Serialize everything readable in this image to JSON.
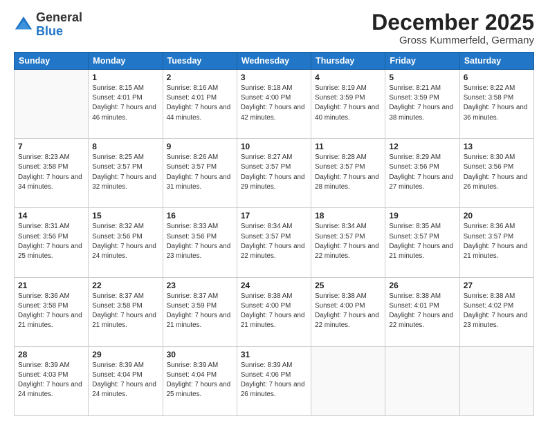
{
  "logo": {
    "general": "General",
    "blue": "Blue"
  },
  "header": {
    "month": "December 2025",
    "location": "Gross Kummerfeld, Germany"
  },
  "days_of_week": [
    "Sunday",
    "Monday",
    "Tuesday",
    "Wednesday",
    "Thursday",
    "Friday",
    "Saturday"
  ],
  "weeks": [
    [
      {
        "day": "",
        "sunrise": "",
        "sunset": "",
        "daylight": ""
      },
      {
        "day": "1",
        "sunrise": "Sunrise: 8:15 AM",
        "sunset": "Sunset: 4:01 PM",
        "daylight": "Daylight: 7 hours and 46 minutes."
      },
      {
        "day": "2",
        "sunrise": "Sunrise: 8:16 AM",
        "sunset": "Sunset: 4:01 PM",
        "daylight": "Daylight: 7 hours and 44 minutes."
      },
      {
        "day": "3",
        "sunrise": "Sunrise: 8:18 AM",
        "sunset": "Sunset: 4:00 PM",
        "daylight": "Daylight: 7 hours and 42 minutes."
      },
      {
        "day": "4",
        "sunrise": "Sunrise: 8:19 AM",
        "sunset": "Sunset: 3:59 PM",
        "daylight": "Daylight: 7 hours and 40 minutes."
      },
      {
        "day": "5",
        "sunrise": "Sunrise: 8:21 AM",
        "sunset": "Sunset: 3:59 PM",
        "daylight": "Daylight: 7 hours and 38 minutes."
      },
      {
        "day": "6",
        "sunrise": "Sunrise: 8:22 AM",
        "sunset": "Sunset: 3:58 PM",
        "daylight": "Daylight: 7 hours and 36 minutes."
      }
    ],
    [
      {
        "day": "7",
        "sunrise": "Sunrise: 8:23 AM",
        "sunset": "Sunset: 3:58 PM",
        "daylight": "Daylight: 7 hours and 34 minutes."
      },
      {
        "day": "8",
        "sunrise": "Sunrise: 8:25 AM",
        "sunset": "Sunset: 3:57 PM",
        "daylight": "Daylight: 7 hours and 32 minutes."
      },
      {
        "day": "9",
        "sunrise": "Sunrise: 8:26 AM",
        "sunset": "Sunset: 3:57 PM",
        "daylight": "Daylight: 7 hours and 31 minutes."
      },
      {
        "day": "10",
        "sunrise": "Sunrise: 8:27 AM",
        "sunset": "Sunset: 3:57 PM",
        "daylight": "Daylight: 7 hours and 29 minutes."
      },
      {
        "day": "11",
        "sunrise": "Sunrise: 8:28 AM",
        "sunset": "Sunset: 3:57 PM",
        "daylight": "Daylight: 7 hours and 28 minutes."
      },
      {
        "day": "12",
        "sunrise": "Sunrise: 8:29 AM",
        "sunset": "Sunset: 3:56 PM",
        "daylight": "Daylight: 7 hours and 27 minutes."
      },
      {
        "day": "13",
        "sunrise": "Sunrise: 8:30 AM",
        "sunset": "Sunset: 3:56 PM",
        "daylight": "Daylight: 7 hours and 26 minutes."
      }
    ],
    [
      {
        "day": "14",
        "sunrise": "Sunrise: 8:31 AM",
        "sunset": "Sunset: 3:56 PM",
        "daylight": "Daylight: 7 hours and 25 minutes."
      },
      {
        "day": "15",
        "sunrise": "Sunrise: 8:32 AM",
        "sunset": "Sunset: 3:56 PM",
        "daylight": "Daylight: 7 hours and 24 minutes."
      },
      {
        "day": "16",
        "sunrise": "Sunrise: 8:33 AM",
        "sunset": "Sunset: 3:56 PM",
        "daylight": "Daylight: 7 hours and 23 minutes."
      },
      {
        "day": "17",
        "sunrise": "Sunrise: 8:34 AM",
        "sunset": "Sunset: 3:57 PM",
        "daylight": "Daylight: 7 hours and 22 minutes."
      },
      {
        "day": "18",
        "sunrise": "Sunrise: 8:34 AM",
        "sunset": "Sunset: 3:57 PM",
        "daylight": "Daylight: 7 hours and 22 minutes."
      },
      {
        "day": "19",
        "sunrise": "Sunrise: 8:35 AM",
        "sunset": "Sunset: 3:57 PM",
        "daylight": "Daylight: 7 hours and 21 minutes."
      },
      {
        "day": "20",
        "sunrise": "Sunrise: 8:36 AM",
        "sunset": "Sunset: 3:57 PM",
        "daylight": "Daylight: 7 hours and 21 minutes."
      }
    ],
    [
      {
        "day": "21",
        "sunrise": "Sunrise: 8:36 AM",
        "sunset": "Sunset: 3:58 PM",
        "daylight": "Daylight: 7 hours and 21 minutes."
      },
      {
        "day": "22",
        "sunrise": "Sunrise: 8:37 AM",
        "sunset": "Sunset: 3:58 PM",
        "daylight": "Daylight: 7 hours and 21 minutes."
      },
      {
        "day": "23",
        "sunrise": "Sunrise: 8:37 AM",
        "sunset": "Sunset: 3:59 PM",
        "daylight": "Daylight: 7 hours and 21 minutes."
      },
      {
        "day": "24",
        "sunrise": "Sunrise: 8:38 AM",
        "sunset": "Sunset: 4:00 PM",
        "daylight": "Daylight: 7 hours and 21 minutes."
      },
      {
        "day": "25",
        "sunrise": "Sunrise: 8:38 AM",
        "sunset": "Sunset: 4:00 PM",
        "daylight": "Daylight: 7 hours and 22 minutes."
      },
      {
        "day": "26",
        "sunrise": "Sunrise: 8:38 AM",
        "sunset": "Sunset: 4:01 PM",
        "daylight": "Daylight: 7 hours and 22 minutes."
      },
      {
        "day": "27",
        "sunrise": "Sunrise: 8:38 AM",
        "sunset": "Sunset: 4:02 PM",
        "daylight": "Daylight: 7 hours and 23 minutes."
      }
    ],
    [
      {
        "day": "28",
        "sunrise": "Sunrise: 8:39 AM",
        "sunset": "Sunset: 4:03 PM",
        "daylight": "Daylight: 7 hours and 24 minutes."
      },
      {
        "day": "29",
        "sunrise": "Sunrise: 8:39 AM",
        "sunset": "Sunset: 4:04 PM",
        "daylight": "Daylight: 7 hours and 24 minutes."
      },
      {
        "day": "30",
        "sunrise": "Sunrise: 8:39 AM",
        "sunset": "Sunset: 4:04 PM",
        "daylight": "Daylight: 7 hours and 25 minutes."
      },
      {
        "day": "31",
        "sunrise": "Sunrise: 8:39 AM",
        "sunset": "Sunset: 4:06 PM",
        "daylight": "Daylight: 7 hours and 26 minutes."
      },
      {
        "day": "",
        "sunrise": "",
        "sunset": "",
        "daylight": ""
      },
      {
        "day": "",
        "sunrise": "",
        "sunset": "",
        "daylight": ""
      },
      {
        "day": "",
        "sunrise": "",
        "sunset": "",
        "daylight": ""
      }
    ]
  ]
}
